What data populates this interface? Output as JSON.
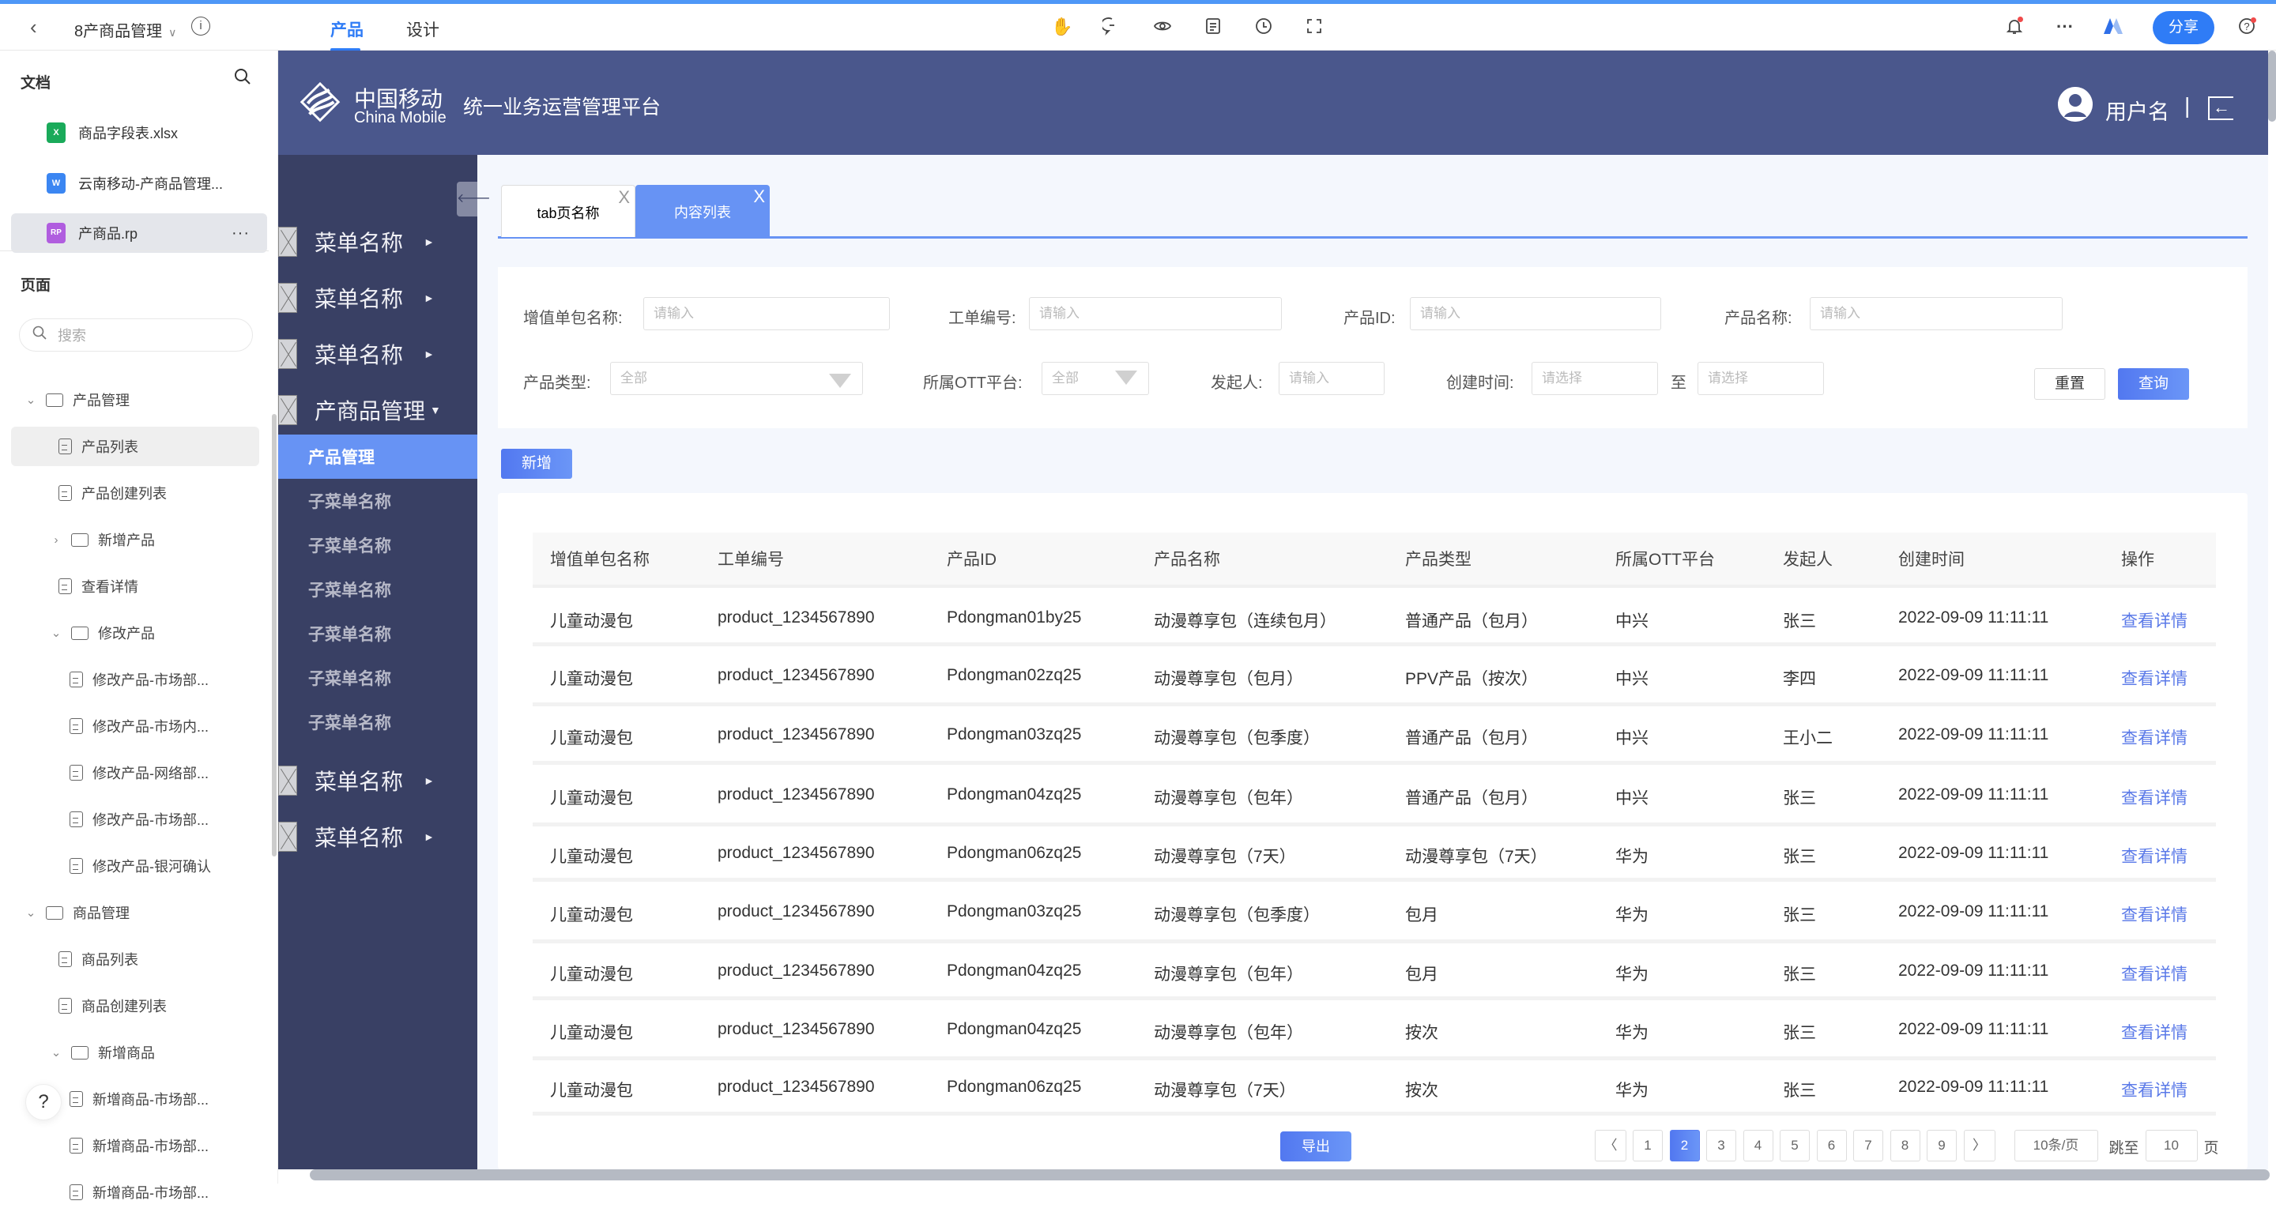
{
  "topbar": {
    "back_icon": "chevron-left-icon",
    "project_title": "8产商品管理",
    "tabs": [
      {
        "label": "产品",
        "active": true
      },
      {
        "label": "设计",
        "active": false
      }
    ],
    "toolbar_icons": [
      "hand-icon",
      "comment-icon",
      "eye-icon",
      "notes-icon",
      "history-icon",
      "fullscreen-icon"
    ],
    "right_icons": [
      "bell-icon",
      "more-icon",
      "logo-icon"
    ],
    "share_label": "分享",
    "help_icon": "help-icon"
  },
  "doc_panel": {
    "docs_heading": "文档",
    "files": [
      {
        "name": "商品字段表.xlsx",
        "type": "X",
        "color": "#1aaa5a"
      },
      {
        "name": "云南移动-产商品管理...",
        "type": "W",
        "color": "#3b86f2"
      },
      {
        "name": "产商品.rp",
        "type": "RP",
        "color": "#b05ddf",
        "selected": true
      }
    ],
    "pages_heading": "页面",
    "search_placeholder": "搜索",
    "tree": [
      {
        "label": "产品管理",
        "kind": "folder",
        "level": 0,
        "expanded": true
      },
      {
        "label": "产品列表",
        "kind": "page",
        "level": 1,
        "selected": true
      },
      {
        "label": "产品创建列表",
        "kind": "page",
        "level": 1
      },
      {
        "label": "新增产品",
        "kind": "folder",
        "level": 1,
        "expanded": false
      },
      {
        "label": "查看详情",
        "kind": "page",
        "level": 1
      },
      {
        "label": "修改产品",
        "kind": "folder",
        "level": 1,
        "expanded": true
      },
      {
        "label": "修改产品-市场部...",
        "kind": "page",
        "level": 2
      },
      {
        "label": "修改产品-市场内...",
        "kind": "page",
        "level": 2
      },
      {
        "label": "修改产品-网络部...",
        "kind": "page",
        "level": 2
      },
      {
        "label": "修改产品-市场部...",
        "kind": "page",
        "level": 2
      },
      {
        "label": "修改产品-银河确认",
        "kind": "page",
        "level": 2
      },
      {
        "label": "商品管理",
        "kind": "folder",
        "level": 0,
        "expanded": true
      },
      {
        "label": "商品列表",
        "kind": "page",
        "level": 1
      },
      {
        "label": "商品创建列表",
        "kind": "page",
        "level": 1
      },
      {
        "label": "新增商品",
        "kind": "folder",
        "level": 1,
        "expanded": true
      },
      {
        "label": "新增商品-市场部...",
        "kind": "page",
        "level": 2
      },
      {
        "label": "新增商品-市场部...",
        "kind": "page",
        "level": 2
      },
      {
        "label": "新增商品-市场部...",
        "kind": "page",
        "level": 2
      }
    ],
    "help_label": "?"
  },
  "app": {
    "logo_cn": "中国移动",
    "logo_en": "China Mobile",
    "title": "统一业务运营管理平台",
    "user_name": "用户名",
    "user_sep": "|",
    "menu": [
      {
        "label": "菜单名称",
        "arrow": "►"
      },
      {
        "label": "菜单名称",
        "arrow": "►"
      },
      {
        "label": "菜单名称",
        "arrow": "►"
      },
      {
        "label": "产商品管理",
        "arrow": "▼",
        "expanded": true
      }
    ],
    "submenu": [
      {
        "label": "产品管理",
        "active": true
      },
      {
        "label": "子菜单名称"
      },
      {
        "label": "子菜单名称"
      },
      {
        "label": "子菜单名称"
      },
      {
        "label": "子菜单名称"
      },
      {
        "label": "子菜单名称"
      },
      {
        "label": "子菜单名称"
      }
    ],
    "menu_after": [
      {
        "label": "菜单名称",
        "arrow": "►"
      },
      {
        "label": "菜单名称",
        "arrow": "►"
      }
    ],
    "tabs": [
      {
        "label": "tab页名称",
        "close": "X"
      },
      {
        "label": "内容列表",
        "close": "X",
        "active": true
      }
    ],
    "filters": {
      "package_name": {
        "label": "增值单包名称:",
        "placeholder": "请输入"
      },
      "order_no": {
        "label": "工单编号:",
        "placeholder": "请输入"
      },
      "product_id": {
        "label": "产品ID:",
        "placeholder": "请输入"
      },
      "product_name": {
        "label": "产品名称:",
        "placeholder": "请输入"
      },
      "product_type": {
        "label": "产品类型:",
        "value": "全部"
      },
      "ott_platform": {
        "label": "所属OTT平台:",
        "value": "全部"
      },
      "initiator": {
        "label": "发起人:",
        "placeholder": "请输入"
      },
      "created_time": {
        "label": "创建时间:",
        "from_placeholder": "请选择",
        "to_label": "至",
        "to_placeholder": "请选择"
      },
      "reset_label": "重置",
      "query_label": "查询"
    },
    "add_label": "新增",
    "table": {
      "columns": [
        "增值单包名称",
        "工单编号",
        "产品ID",
        "产品名称",
        "产品类型",
        "所属OTT平台",
        "发起人",
        "创建时间",
        "操作"
      ],
      "rows": [
        [
          "儿童动漫包",
          "product_1234567890",
          "Pdongman01by25",
          "动漫尊享包（连续包月）",
          "普通产品（包月）",
          "中兴",
          "张三",
          "2022-09-09 11:11:11",
          "查看详情"
        ],
        [
          "儿童动漫包",
          "product_1234567890",
          "Pdongman02zq25",
          "动漫尊享包（包月）",
          "PPV产品（按次）",
          "中兴",
          "李四",
          "2022-09-09 11:11:11",
          "查看详情"
        ],
        [
          "儿童动漫包",
          "product_1234567890",
          "Pdongman03zq25",
          "动漫尊享包（包季度）",
          "普通产品（包月）",
          "中兴",
          "王小二",
          "2022-09-09 11:11:11",
          "查看详情"
        ],
        [
          "儿童动漫包",
          "product_1234567890",
          "Pdongman04zq25",
          "动漫尊享包（包年）",
          "普通产品（包月）",
          "中兴",
          "张三",
          "2022-09-09 11:11:11",
          "查看详情"
        ],
        [
          "儿童动漫包",
          "product_1234567890",
          "Pdongman06zq25",
          "动漫尊享包（7天）",
          "动漫尊享包（7天）",
          "华为",
          "张三",
          "2022-09-09 11:11:11",
          "查看详情"
        ],
        [
          "儿童动漫包",
          "product_1234567890",
          "Pdongman03zq25",
          "动漫尊享包（包季度）",
          "包月",
          "华为",
          "张三",
          "2022-09-09 11:11:11",
          "查看详情"
        ],
        [
          "儿童动漫包",
          "product_1234567890",
          "Pdongman04zq25",
          "动漫尊享包（包年）",
          "包月",
          "华为",
          "张三",
          "2022-09-09 11:11:11",
          "查看详情"
        ],
        [
          "儿童动漫包",
          "product_1234567890",
          "Pdongman04zq25",
          "动漫尊享包（包年）",
          "按次",
          "华为",
          "张三",
          "2022-09-09 11:11:11",
          "查看详情"
        ],
        [
          "儿童动漫包",
          "product_1234567890",
          "Pdongman06zq25",
          "动漫尊享包（7天）",
          "按次",
          "华为",
          "张三",
          "2022-09-09 11:11:11",
          "查看详情"
        ]
      ]
    },
    "export_label": "导出",
    "pagination": {
      "prev": "〈",
      "next": "〉",
      "pages": [
        "1",
        "2",
        "3",
        "4",
        "5",
        "6",
        "7",
        "8",
        "9"
      ],
      "current": "2",
      "page_size": "10条/页",
      "jump_label": "跳至",
      "jump_value": "10",
      "page_suffix": "页"
    },
    "colors": {
      "header": "#4a578c",
      "menu": "#394064",
      "accent": "#6793f4",
      "link": "#5a79e8"
    }
  }
}
